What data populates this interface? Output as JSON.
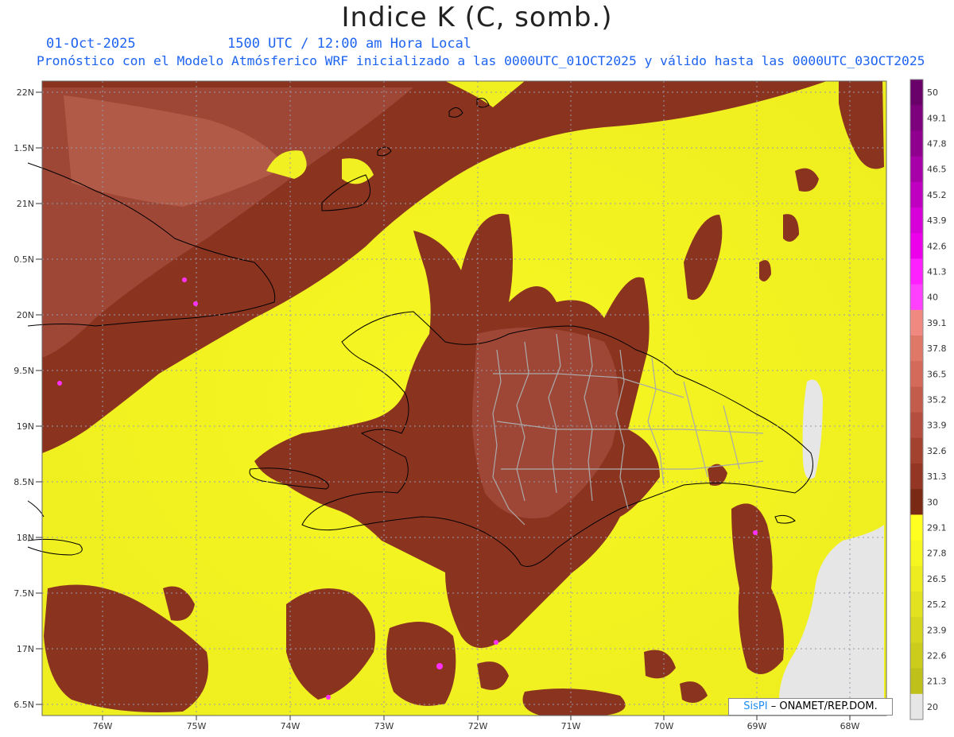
{
  "header": {
    "title": "Indice K (C, somb.)",
    "date": "01-Oct-2025",
    "time": "1500 UTC / 12:00 am Hora Local",
    "description": "Pronóstico con el Modelo Atmósferico WRF inicializado a las 0000UTC_01OCT2025 y válido hasta las  0000UTC_03OCT2025"
  },
  "map": {
    "lat_labels": [
      "22N",
      "1.5N",
      "21N",
      "0.5N",
      "20N",
      "9.5N",
      "19N",
      "8.5N",
      "18N",
      "7.5N",
      "17N",
      "6.5N"
    ],
    "lon_labels": [
      "76W",
      "75W",
      "74W",
      "73W",
      "72W",
      "71W",
      "70W",
      "69W",
      "68W"
    ]
  },
  "colorbar": {
    "labels": [
      "50",
      "49.1",
      "47.8",
      "46.5",
      "45.2",
      "43.9",
      "42.6",
      "41.3",
      "40",
      "39.1",
      "37.8",
      "36.5",
      "35.2",
      "33.9",
      "32.6",
      "31.3",
      "30",
      "29.1",
      "27.8",
      "26.5",
      "25.2",
      "23.9",
      "22.6",
      "21.3",
      "20"
    ],
    "colors": [
      "#6a006a",
      "#7d007d",
      "#90008f",
      "#a800a8",
      "#c000c0",
      "#d800d8",
      "#ec00ec",
      "#ff20ff",
      "#ff40ff",
      "#f08a80",
      "#e07868",
      "#d46a5a",
      "#c45c4c",
      "#b44e3e",
      "#a44230",
      "#943624",
      "#7a2a14",
      "#ffff20",
      "#f6f620",
      "#ecec20",
      "#e2e220",
      "#d6d61e",
      "#cccc1c",
      "#c0c01a",
      "#e6e6e6"
    ]
  },
  "credit": {
    "brand": "SisPI",
    "org": " – ONAMET/REP.DOM."
  }
}
